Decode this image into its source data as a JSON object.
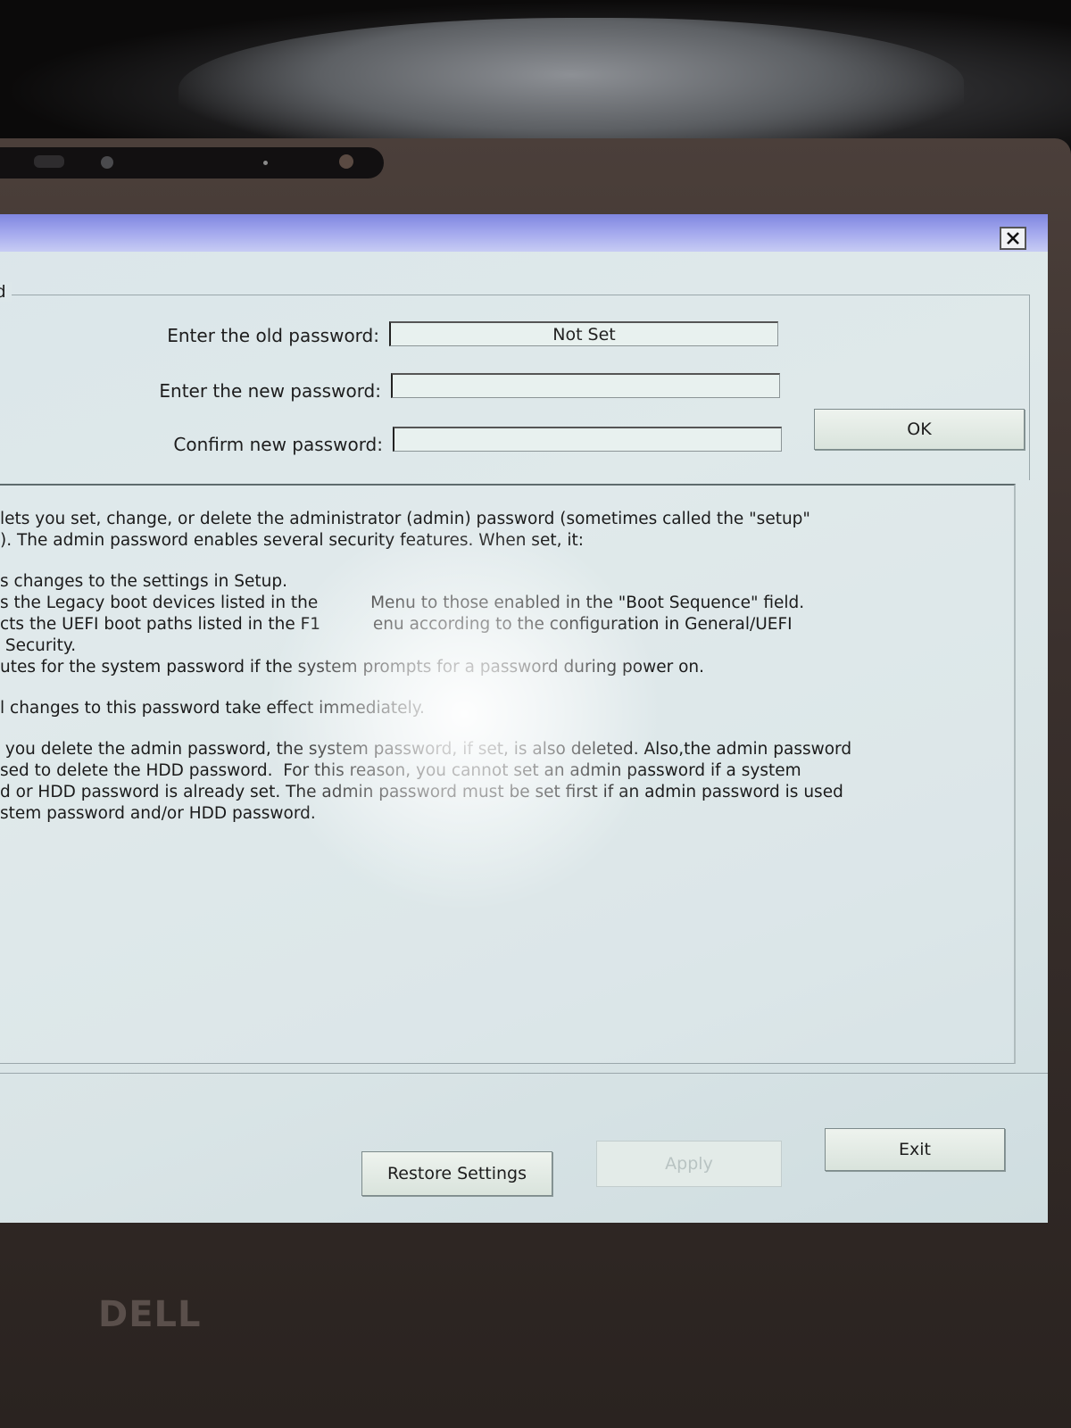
{
  "dialog": {
    "group_title": "word",
    "old_password_label": "Enter the old password:",
    "old_password_value": "Not Set",
    "new_password_label": "Enter the new password:",
    "new_password_value": "",
    "confirm_password_label": "Confirm new password:",
    "confirm_password_value": "",
    "ok_label": "OK"
  },
  "help": {
    "lines": [
      "lets you set, change, or delete the administrator (admin) password (sometimes called the \"setup\"",
      "). The admin password enables several security features. When set, it:",
      "",
      "s changes to the settings in Setup.",
      "s the Legacy boot devices listed in the          Menu to those enabled in the \"Boot Sequence\" field.",
      "cts the UEFI boot paths listed in the F1          enu according to the configuration in General/UEFI",
      " Security.",
      "utes for the system password if the system prompts for a password during power on.",
      "",
      "l changes to this password take effect immediately.",
      "",
      " you delete the admin password, the system password, if set, is also deleted. Also,the admin password",
      "sed to delete the HDD password.  For this reason, you cannot set an admin password if a system",
      "d or HDD password is already set. The admin password must be set first if an admin password is used",
      "stem password and/or HDD password."
    ]
  },
  "footer": {
    "restore_label": "Restore Settings",
    "apply_label": "Apply",
    "exit_label": "Exit"
  },
  "bezel": {
    "brand": "DELL"
  },
  "colors": {
    "titlebar": "#7f86e0",
    "screen_bg": "#dbe6ea",
    "bezel": "#3a302d"
  },
  "icons": {
    "close": "close-icon"
  }
}
